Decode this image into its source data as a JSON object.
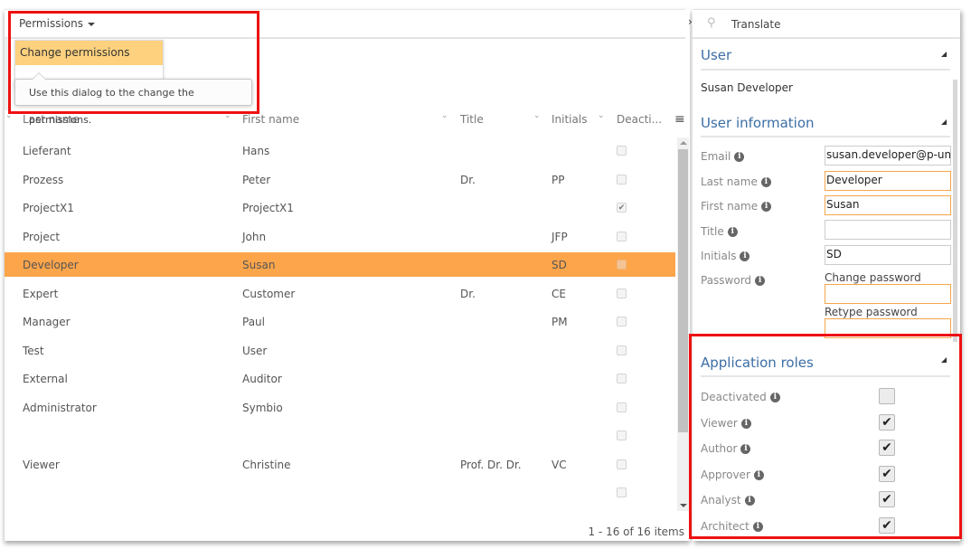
{
  "toolbar": {
    "permissions_label": "Permissions",
    "collapse_icon": "›"
  },
  "dropdown": {
    "items": [
      {
        "label": "Change permissions"
      }
    ]
  },
  "tooltip": {
    "text": "Use this dialog to the change the permissions."
  },
  "grid": {
    "columns": [
      {
        "label": "Last name"
      },
      {
        "label": "First name"
      },
      {
        "label": "Title"
      },
      {
        "label": "Initials"
      },
      {
        "label": "Deacti..."
      }
    ],
    "rows": [
      {
        "last": "Lieferant",
        "first": "Hans",
        "title": "",
        "initials": "",
        "deactivated": false,
        "selected": false
      },
      {
        "last": "Prozess",
        "first": "Peter",
        "title": "Dr.",
        "initials": "PP",
        "deactivated": false,
        "selected": false
      },
      {
        "last": "ProjectX1",
        "first": "ProjectX1",
        "title": "",
        "initials": "",
        "deactivated": true,
        "selected": false
      },
      {
        "last": "Project",
        "first": "John",
        "title": "",
        "initials": "JFP",
        "deactivated": false,
        "selected": false
      },
      {
        "last": "Developer",
        "first": "Susan",
        "title": "",
        "initials": "SD",
        "deactivated": false,
        "selected": true
      },
      {
        "last": "Expert",
        "first": "Customer",
        "title": "Dr.",
        "initials": "CE",
        "deactivated": false,
        "selected": false
      },
      {
        "last": "Manager",
        "first": "Paul",
        "title": "",
        "initials": "PM",
        "deactivated": false,
        "selected": false
      },
      {
        "last": "Test",
        "first": "User",
        "title": "",
        "initials": "",
        "deactivated": false,
        "selected": false
      },
      {
        "last": "External",
        "first": "Auditor",
        "title": "",
        "initials": "",
        "deactivated": false,
        "selected": false
      },
      {
        "last": "Administrator",
        "first": "Symbio",
        "title": "",
        "initials": "",
        "deactivated": false,
        "selected": false
      },
      {
        "last": "",
        "first": "",
        "title": "",
        "initials": "",
        "deactivated": false,
        "selected": false
      },
      {
        "last": "Viewer",
        "first": "Christine",
        "title": "Prof. Dr. Dr.",
        "initials": "VC",
        "deactivated": false,
        "selected": false
      },
      {
        "last": "",
        "first": "",
        "title": "",
        "initials": "",
        "deactivated": false,
        "selected": false
      }
    ],
    "pager": "1 - 16 of 16 items"
  },
  "side": {
    "translate_label": "Translate",
    "user_section": {
      "title": "User",
      "name": "Susan Developer"
    },
    "info_section": {
      "title": "User information",
      "fields": {
        "email": {
          "label": "Email",
          "value": "susan.developer@p-und-z"
        },
        "last_name": {
          "label": "Last name",
          "value": "Developer"
        },
        "first_name": {
          "label": "First name",
          "value": "Susan"
        },
        "title": {
          "label": "Title",
          "value": ""
        },
        "initials": {
          "label": "Initials",
          "value": "SD"
        },
        "password": {
          "label": "Password",
          "change_label": "Change password",
          "retype_label": "Retype password"
        }
      }
    },
    "roles_section": {
      "title": "Application roles",
      "roles": [
        {
          "label": "Deactivated",
          "checked": false
        },
        {
          "label": "Viewer",
          "checked": true
        },
        {
          "label": "Author",
          "checked": true
        },
        {
          "label": "Approver",
          "checked": true
        },
        {
          "label": "Analyst",
          "checked": true
        },
        {
          "label": "Architect",
          "checked": true
        }
      ]
    }
  },
  "colors": {
    "selected_row": "#fda54b",
    "menu_highlight": "#fdd17e",
    "required_border": "#f5a54a",
    "section_title": "#3b6ea5",
    "annotation": "#ee1111"
  }
}
